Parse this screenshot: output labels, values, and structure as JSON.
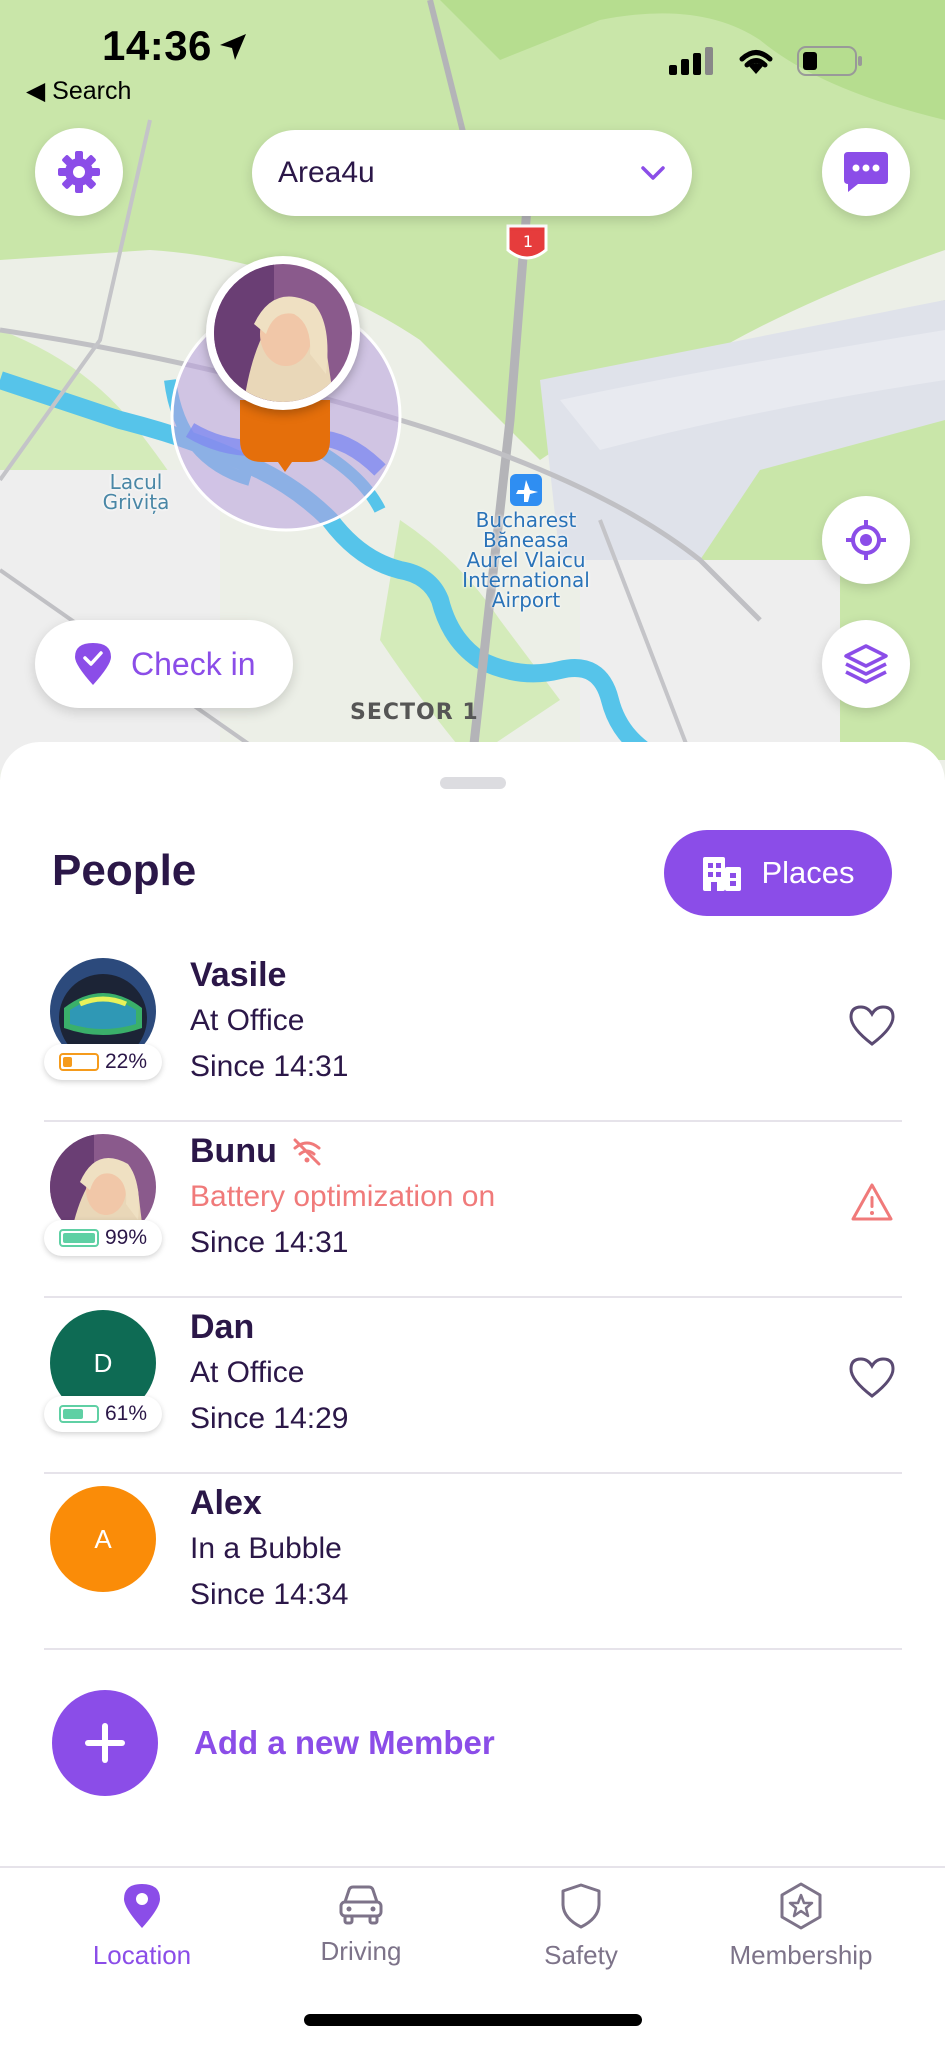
{
  "status_bar": {
    "time": "14:36",
    "back_label": "◀ Search"
  },
  "map": {
    "circle_name": "Area4u",
    "checkin_label": "Check in",
    "labels": {
      "lake": "Lacul\nGrivița",
      "airport": "Bucharest\nBăneasa\nAurel Vlaicu\nInternational\nAirport",
      "sector": "SECTOR 1",
      "road_shield": "1"
    }
  },
  "sheet": {
    "title": "People",
    "places_label": "Places",
    "members": [
      {
        "name": "Vasile",
        "status": "At Office",
        "since": "Since 14:31",
        "battery": "22%",
        "battery_level": 0.22,
        "battery_color": "#f59b1c",
        "avatar": "goggles",
        "action": "heart-icon",
        "warning": false
      },
      {
        "name": "Bunu",
        "status": "Battery optimization on",
        "since": "Since 14:31",
        "battery": "99%",
        "battery_level": 0.99,
        "battery_color": "#5fd0a4",
        "avatar": "photo",
        "action": "warning-icon",
        "warning": true
      },
      {
        "name": "Dan",
        "status": "At Office",
        "since": "Since 14:29",
        "battery": "61%",
        "battery_level": 0.61,
        "battery_color": "#5fd0a4",
        "avatar_initial": "D",
        "avatar_color": "#0e6b54",
        "action": "heart-icon",
        "warning": false
      },
      {
        "name": "Alex",
        "status": "In a Bubble",
        "since": "Since 14:34",
        "avatar_initial": "A",
        "avatar_color": "#fa8c08",
        "warning": false
      }
    ],
    "add_member_label": "Add a new Member"
  },
  "tabs": [
    {
      "label": "Location",
      "icon": "location-pin-icon",
      "active": true
    },
    {
      "label": "Driving",
      "icon": "car-icon",
      "active": false
    },
    {
      "label": "Safety",
      "icon": "shield-icon",
      "active": false
    },
    {
      "label": "Membership",
      "icon": "star-badge-icon",
      "active": false
    }
  ],
  "colors": {
    "accent": "#8b4de8",
    "text": "#2b1748",
    "warning": "#f07a7a",
    "muted": "#7d7389"
  }
}
